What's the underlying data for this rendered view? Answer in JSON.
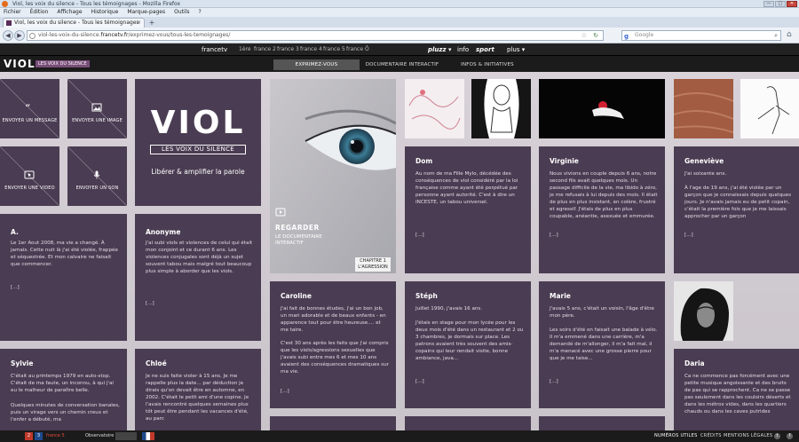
{
  "browser": {
    "title": "Viol, les voix du silence - Tous les témoignages - Mozilla Firefox",
    "menu": [
      "Fichier",
      "Édition",
      "Affichage",
      "Historique",
      "Marque-pages",
      "Outils",
      "?"
    ],
    "tab_title": "Viol, les voix du silence - Tous les témoignages",
    "url_prefix": "viol-les-voix-du-silence.",
    "url_domain": "francetv.fr",
    "url_suffix": "/exprimez-vous/tous-les-temoignages/",
    "search_placeholder": "Google",
    "window_buttons": [
      "—",
      "□",
      "✕"
    ]
  },
  "ftv": {
    "brand": "francetv",
    "channels": [
      "1ère",
      "france 2",
      "france 3",
      "france 4",
      "france 5",
      "france Ô"
    ],
    "pluzz": "pluzz ▾",
    "info": "info",
    "sport": "sport",
    "plus": "plus ▾"
  },
  "site": {
    "logo": "VIOL",
    "logo_sub": "LES VOIX DU SILENCE",
    "nav": [
      "EXPRIMEZ-VOUS",
      "DOCUMENTAIRE INTERACTIF",
      "INFOS & INITIATIVES"
    ]
  },
  "links": {
    "message": "ENVOYER UN MESSAGE",
    "image": "ENVOYER UNE IMAGE",
    "video": "ENVOYER UNE VIDEO",
    "sound": "ENVOYER UN SON"
  },
  "hero": {
    "title": "VIOL",
    "subtitle": "LES VOIX DU SILENCE",
    "tagline": "Libérer & amplifier la parole"
  },
  "video": {
    "label": "REGARDER",
    "sub1": "LE DOCUMENTAIRE",
    "sub2": "INTERACTIF",
    "chapter1": "CHAPITRE 1",
    "chapter2": "L'AGRESSION"
  },
  "testimonies": {
    "dom": {
      "name": "Dom",
      "text": "Au nom de ma Fille Mylo, décédée des conséquences de viol considéré par la loi française comme ayant été perpétué par personne ayant autorité. C'est à dire un INCESTE, un tabou universel.",
      "more": "[...]"
    },
    "virginie": {
      "name": "Virginie",
      "text": "Nous vivions en couple depuis 6 ans, notre second fils avait quelques mois. Un passage difficile de la vie, ma libido à zéro, je me refusais à lui depuis des mois. Il était de plus en plus insistant, en colère, frustré et agressif. J'étais de plus en plus coupable, anéantie, asexuée et emmurée.",
      "more": "[...]"
    },
    "genevieve": {
      "name": "Geneviève",
      "text1": "J'ai soixante ans.",
      "text2": "À l'age de 19 ans, j'ai été violée par un garçon que je connaissais depuis quelques jours. Je n'avais jamais eu de petit copain, c'était la première fois que je me laissais approcher par un garçon",
      "more": "[...]"
    },
    "a": {
      "name": "A.",
      "text": "Le 1er Aout 2008, ma vie a changé. À jamais. Cette nuit là j'ai été violée, frappée et séquestrée. Et mon calvaire ne faisait que commencer.",
      "more": "[...]"
    },
    "anonyme": {
      "name": "Anonyme",
      "text": "J'ai subi viols et violences de celui qui était mon conjoint et ce durant 6 ans. Les violences conjugales sont déjà un sujet souvent tabou mais malgré tout beaucoup plus simple à aborder que les viols.",
      "more": "[...]"
    },
    "caroline": {
      "name": "Caroline",
      "text1": "J'ai fait de bonnes études, j'ai un bon job, un mari adorable et de beaux enfants - en apparence tout pour être heureuse.... et me taire.",
      "text2": "C'est 30 ans après les faits que j'ai compris que les viols/agressions sexuelles que j'avais subi entre mes 6 et mes 10 ans avaient des conséquences dramatiques sur ma vie.",
      "more": "[...]"
    },
    "steph": {
      "name": "Stéph",
      "text1": "Juillet 1990, j'avais 16 ans.",
      "text2": "J'étais en stage pour mon lycée pour les deux mois d'été dans un restaurant et 2 ou 3 chambres, je dormais sur place. Les patrons avaient très souvent des amis-copains qui leur rendait visite, bonne ambiance, java...",
      "more": "[...]"
    },
    "marie": {
      "name": "Marie",
      "text1": "J'avais 5 ans, c'était un voisin, l'âge d'être mon père.",
      "text2": "Les soirs d'été on faisait une balade à vélo. Il m'a emmené dans une carrière, m'a demandé de m'allonger, il m'a fait mal, il m'a menacé avec une grosse pierre pour que je me taise...",
      "more": "[...]"
    },
    "sylvie": {
      "name": "Sylvie",
      "text1": "C'était au printemps 1979 en auto-stop. C'était de ma faute, un inconnu, à qui j'ai eu le malheur de paraître belle.",
      "text2": "Quelques minutes de conversation banales, puis un virage vers un chemin creux et l'enfer a débuté, ma"
    },
    "chloe": {
      "name": "Chloé",
      "text": "Je ne suis faite violer à 15 ans. Je me rappelle plus la date... par déduction je dirais qu'on devait être en automne, en 2002. C'était le petit ami d'une copine. Je l'avais rencontré quelques semaines plus tôt peut être pendant les vacances d'été, au parc"
    },
    "daria": {
      "name": "Daria",
      "text": "Ca ne commence pas forcément avec une petite musique angoissante et des bruits de pas qui se rapprochent. Ca ne se passe pas seulement dans les couloirs déserts et dans les métros vides, dans les quartiers chauds ou dans les caves putrides"
    }
  },
  "footer": {
    "logos": [
      "2",
      "3",
      "france 5",
      "Observatoire",
      "",
      ""
    ],
    "links": [
      "NUMÉROS UTILES",
      "CRÉDITS",
      "MENTIONS LÉGALES"
    ],
    "social": [
      "t",
      "f"
    ]
  },
  "colors": {
    "tile": "#4a3c52",
    "header": "#1b1b1b",
    "accent": "#7a4f7a"
  }
}
